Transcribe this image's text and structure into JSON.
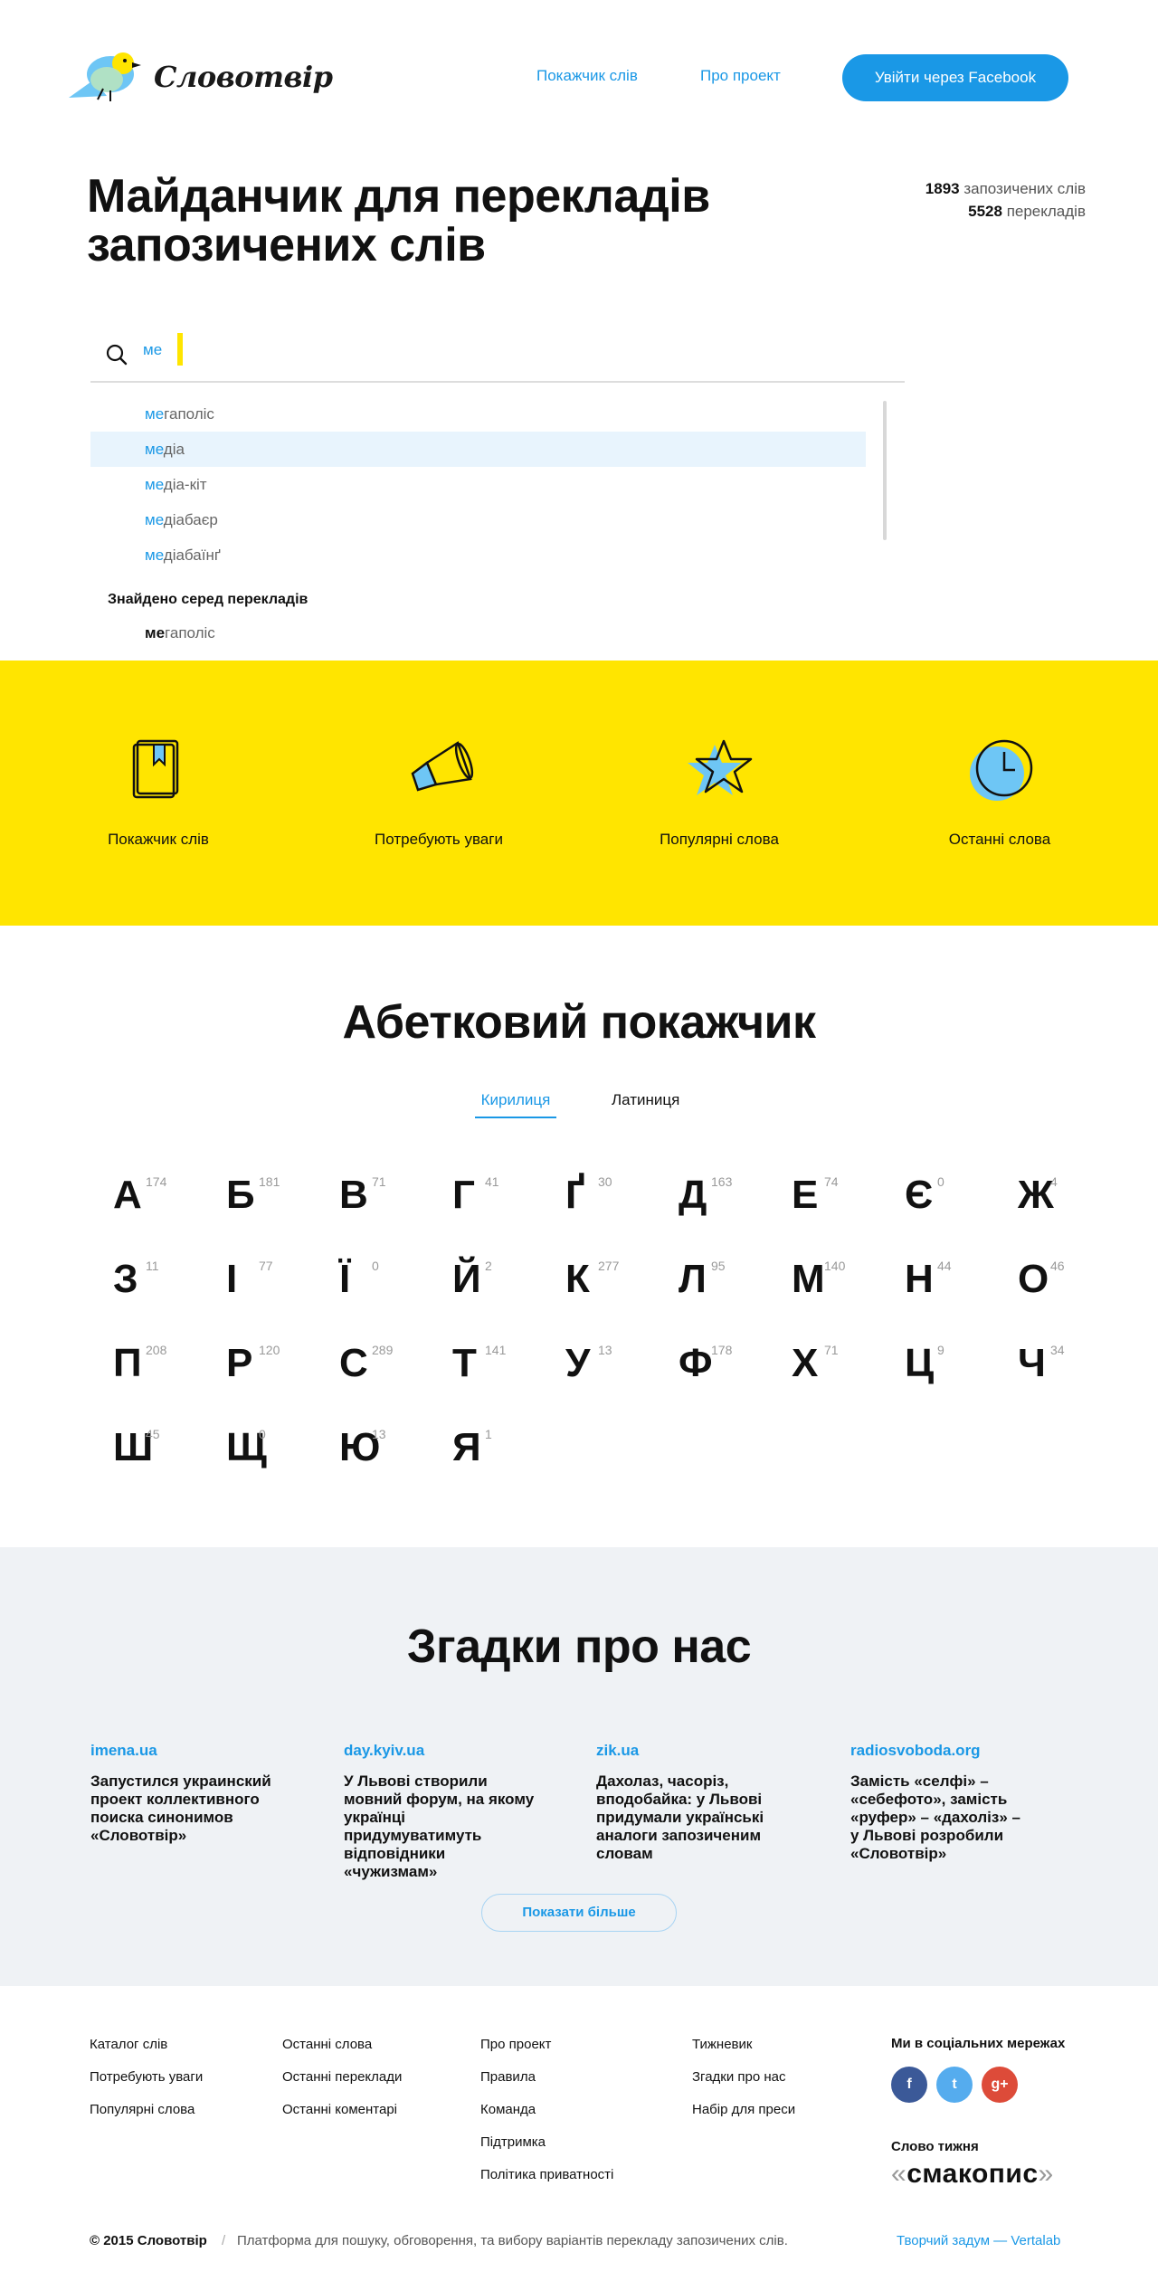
{
  "header": {
    "logo_text": "Словотвір",
    "nav": [
      "Покажчик слів",
      "Про проект"
    ],
    "login_button": "Увійти через Facebook"
  },
  "hero": {
    "title_line1": "Майданчик для перекладів",
    "title_line2": "запозичених слів",
    "stats": {
      "borrowed_count": "1893",
      "borrowed_label": "запозичених слів",
      "translations_count": "5528",
      "translations_label": "перекладів"
    }
  },
  "search": {
    "value": "ме",
    "suggestions": [
      {
        "match": "ме",
        "rest": "гаполіс"
      },
      {
        "match": "ме",
        "rest": "діа"
      },
      {
        "match": "ме",
        "rest": "діа-кіт"
      },
      {
        "match": "ме",
        "rest": "діабаєр"
      },
      {
        "match": "ме",
        "rest": "діабаїнґ"
      }
    ],
    "highlighted_index": 1,
    "found_title": "Знайдено серед перекладів",
    "found_item": {
      "match": "ме",
      "rest": "гаполіс"
    }
  },
  "categories": [
    {
      "label": "Покажчик слів",
      "icon": "book-icon"
    },
    {
      "label": "Потребують уваги",
      "icon": "megaphone-icon"
    },
    {
      "label": "Популярні слова",
      "icon": "star-icon"
    },
    {
      "label": "Останні слова",
      "icon": "clock-icon"
    }
  ],
  "alphabet": {
    "title": "Абетковий покажчик",
    "tabs": [
      "Кирилиця",
      "Латиниця"
    ],
    "active_tab": "Кирилиця",
    "letters": [
      {
        "ch": "А",
        "n": "174"
      },
      {
        "ch": "Б",
        "n": "181"
      },
      {
        "ch": "В",
        "n": "71"
      },
      {
        "ch": "Г",
        "n": "41"
      },
      {
        "ch": "Ґ",
        "n": "30"
      },
      {
        "ch": "Д",
        "n": "163"
      },
      {
        "ch": "Е",
        "n": "74"
      },
      {
        "ch": "Є",
        "n": "0"
      },
      {
        "ch": "Ж",
        "n": "4"
      },
      {
        "ch": "З",
        "n": "11"
      },
      {
        "ch": "І",
        "n": "77"
      },
      {
        "ch": "Ї",
        "n": "0"
      },
      {
        "ch": "Й",
        "n": "2"
      },
      {
        "ch": "К",
        "n": "277"
      },
      {
        "ch": "Л",
        "n": "95"
      },
      {
        "ch": "М",
        "n": "140"
      },
      {
        "ch": "Н",
        "n": "44"
      },
      {
        "ch": "О",
        "n": "46"
      },
      {
        "ch": "П",
        "n": "208"
      },
      {
        "ch": "Р",
        "n": "120"
      },
      {
        "ch": "С",
        "n": "289"
      },
      {
        "ch": "Т",
        "n": "141"
      },
      {
        "ch": "У",
        "n": "13"
      },
      {
        "ch": "Ф",
        "n": "178"
      },
      {
        "ch": "Х",
        "n": "71"
      },
      {
        "ch": "Ц",
        "n": "9"
      },
      {
        "ch": "Ч",
        "n": "34"
      },
      {
        "ch": "Ш",
        "n": "45"
      },
      {
        "ch": "Щ",
        "n": "0"
      },
      {
        "ch": "Ю",
        "n": "13"
      },
      {
        "ch": "Я",
        "n": "1"
      }
    ]
  },
  "mentions": {
    "title": "Згадки про нас",
    "items": [
      {
        "source": "imena.ua",
        "text": "Запустился украинский проект коллективного поиска синонимов «Словотвір»"
      },
      {
        "source": "day.kyiv.ua",
        "text": "У Львові створили мовний форум, на якому українці придумуватимуть відповідники «чужизмам»"
      },
      {
        "source": "zik.ua",
        "text": "Дахолаз, часоріз, вподобайка: у Львові придумали українські аналоги запозиченим словам"
      },
      {
        "source": "radiosvoboda.org",
        "text": "Замість «селфі» – «себефото», замість «руфер» – «дахоліз» – у Львові розробили «Словотвір»"
      }
    ],
    "more_button": "Показати більше"
  },
  "footer": {
    "columns": [
      [
        "Каталог слів",
        "Потребують уваги",
        "Популярні слова"
      ],
      [
        "Останні слова",
        "Останні переклади",
        "Останні коментарі"
      ],
      [
        "Про проект",
        "Правила",
        "Команда",
        "Підтримка",
        "Політика приватності"
      ],
      [
        "Тижневик",
        "Згадки про нас",
        "Набір для преси"
      ]
    ],
    "social_title": "Ми в соціальних мережах",
    "social": [
      {
        "label": "f",
        "color": "#3b5998"
      },
      {
        "label": "t",
        "color": "#55acee"
      },
      {
        "label": "g+",
        "color": "#dd4b39"
      }
    ],
    "word_of_week_title": "Слово тижня",
    "word_of_week": "смакопис",
    "copyright": "© 2015 Словотвір",
    "separator": "/",
    "tagline": "Платформа для пошуку, обговорення, та вибору варіантів перекладу запозичених слів.",
    "credit": "Творчий задум — Vertalab"
  },
  "colors": {
    "accent": "#1a98e6",
    "yellow": "#ffe500",
    "gray_bg": "#eff2f5"
  }
}
